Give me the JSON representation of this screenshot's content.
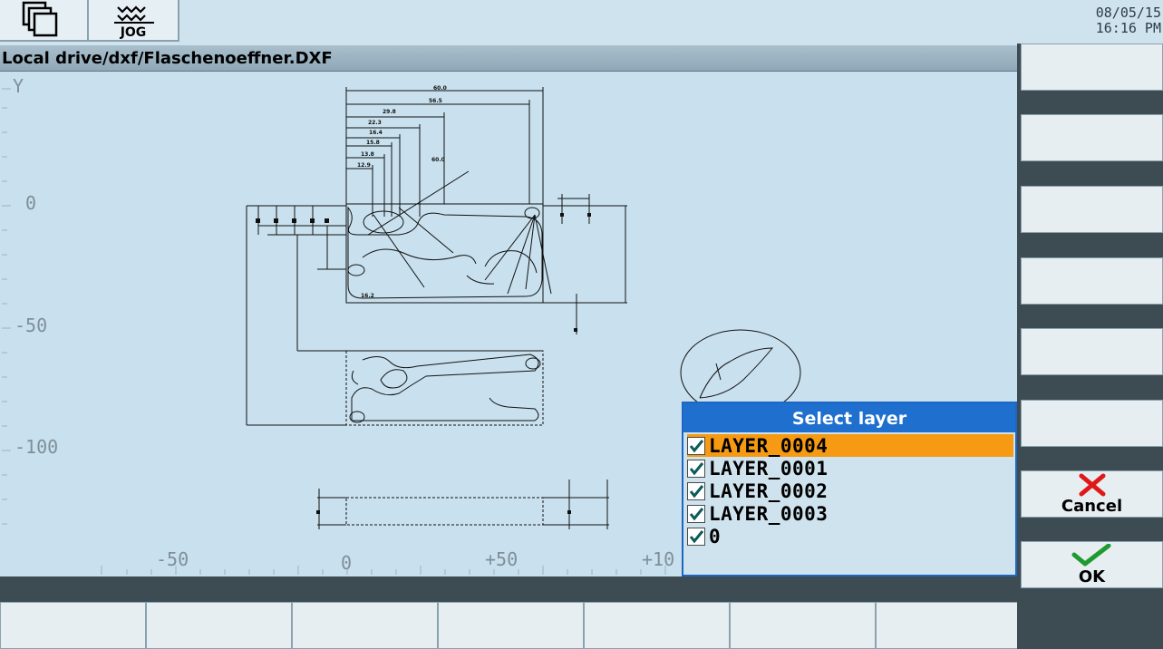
{
  "header": {
    "jog_label": "JOG",
    "date": "08/05/15",
    "time": "16:16 PM"
  },
  "path": "Local drive/dxf/Flaschenoeffner.DXF",
  "axes": {
    "y_label": "Y",
    "y_ticks": [
      "0",
      "-50",
      "-100"
    ],
    "x_ticks": [
      "-50",
      "0",
      "+50",
      "+10"
    ]
  },
  "dimensions": [
    "60.0",
    "56.5",
    "29.8",
    "22.3",
    "16.4",
    "15.8",
    "13.8",
    "12.9",
    "60.0",
    "16.2"
  ],
  "dialog": {
    "title": "Select layer",
    "layers": [
      {
        "name": "LAYER_0004",
        "checked": true,
        "selected": true
      },
      {
        "name": "LAYER_0001",
        "checked": true,
        "selected": false
      },
      {
        "name": "LAYER_0002",
        "checked": true,
        "selected": false
      },
      {
        "name": "LAYER_0003",
        "checked": true,
        "selected": false
      },
      {
        "name": "0",
        "checked": true,
        "selected": false
      }
    ]
  },
  "softkeys": {
    "cancel_label": "Cancel",
    "ok_label": "OK"
  },
  "colors": {
    "dialog_title_bg": "#1f6fcf",
    "selected_row": "#f59a12",
    "cancel_icon": "#e01818",
    "ok_icon": "#1e9a2e"
  }
}
